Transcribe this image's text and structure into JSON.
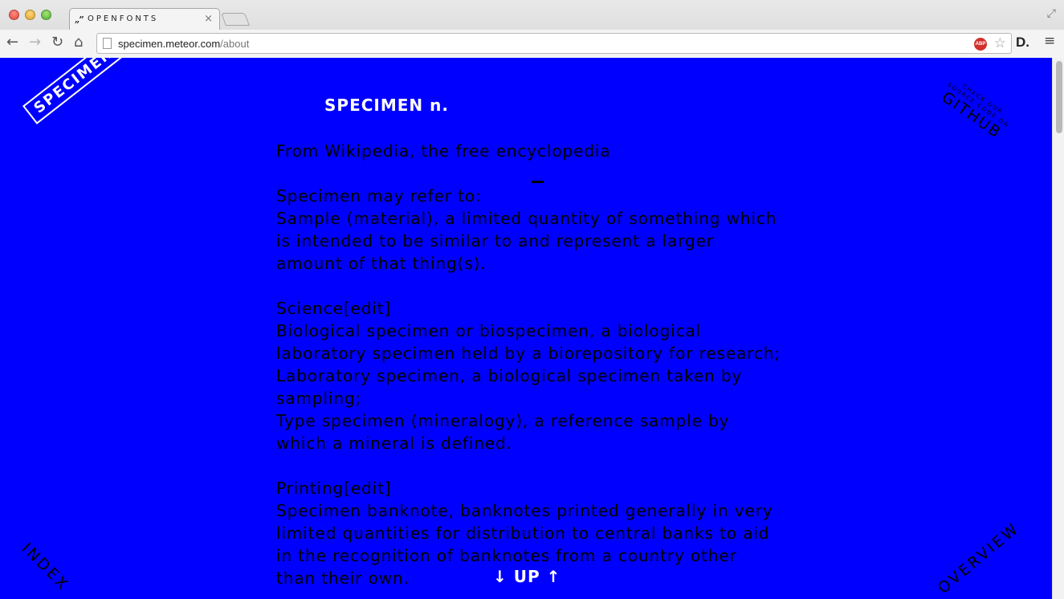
{
  "browser": {
    "tab_favicon": "„”",
    "tab_title": "OPENFONTS",
    "tab_close": "×",
    "url_host": "specimen.meteor.com",
    "url_path": "/about",
    "back": "←",
    "forward": "→",
    "reload": "↻",
    "home": "⌂",
    "abp_label": "ABP",
    "star": "☆",
    "extension_label": "D.",
    "menu": "≡"
  },
  "page": {
    "logo": "SPECIMEN",
    "github_small_1": "CHECK OUR",
    "github_small_2": "SOURCE CODE ON",
    "github_big": "GITHUB",
    "index_link": "INDEX",
    "overview_link": "OVERVIEW",
    "title": "SPECIMEN n.",
    "subtitle": "From Wikipedia, the free encyclopedia",
    "intro": "Specimen may refer to:",
    "sample_lines": [
      "Sample (material), a limited quantity of something which",
      "is intended to be similar to and represent a larger",
      "amount of that thing(s)."
    ],
    "science_heading": "Science[edit]",
    "science_lines": [
      "Biological specimen or biospecimen, a biological",
      "laboratory specimen held by a biorepository for research;",
      "Laboratory specimen, a biological specimen taken by",
      "sampling;",
      "Type specimen (mineralogy), a reference sample by",
      "which a mineral is defined."
    ],
    "printing_heading": "Printing[edit]",
    "printing_lines": [
      "Specimen banknote, banknotes printed generally in very",
      "limited quantities for distribution to central banks to aid",
      "in the recognition of banknotes from a country other",
      "than their own."
    ],
    "up_button": "↓ UP ↑"
  },
  "colors": {
    "page_background": "#0000ff",
    "accent_text": "#ffffff",
    "body_text": "#000000"
  }
}
